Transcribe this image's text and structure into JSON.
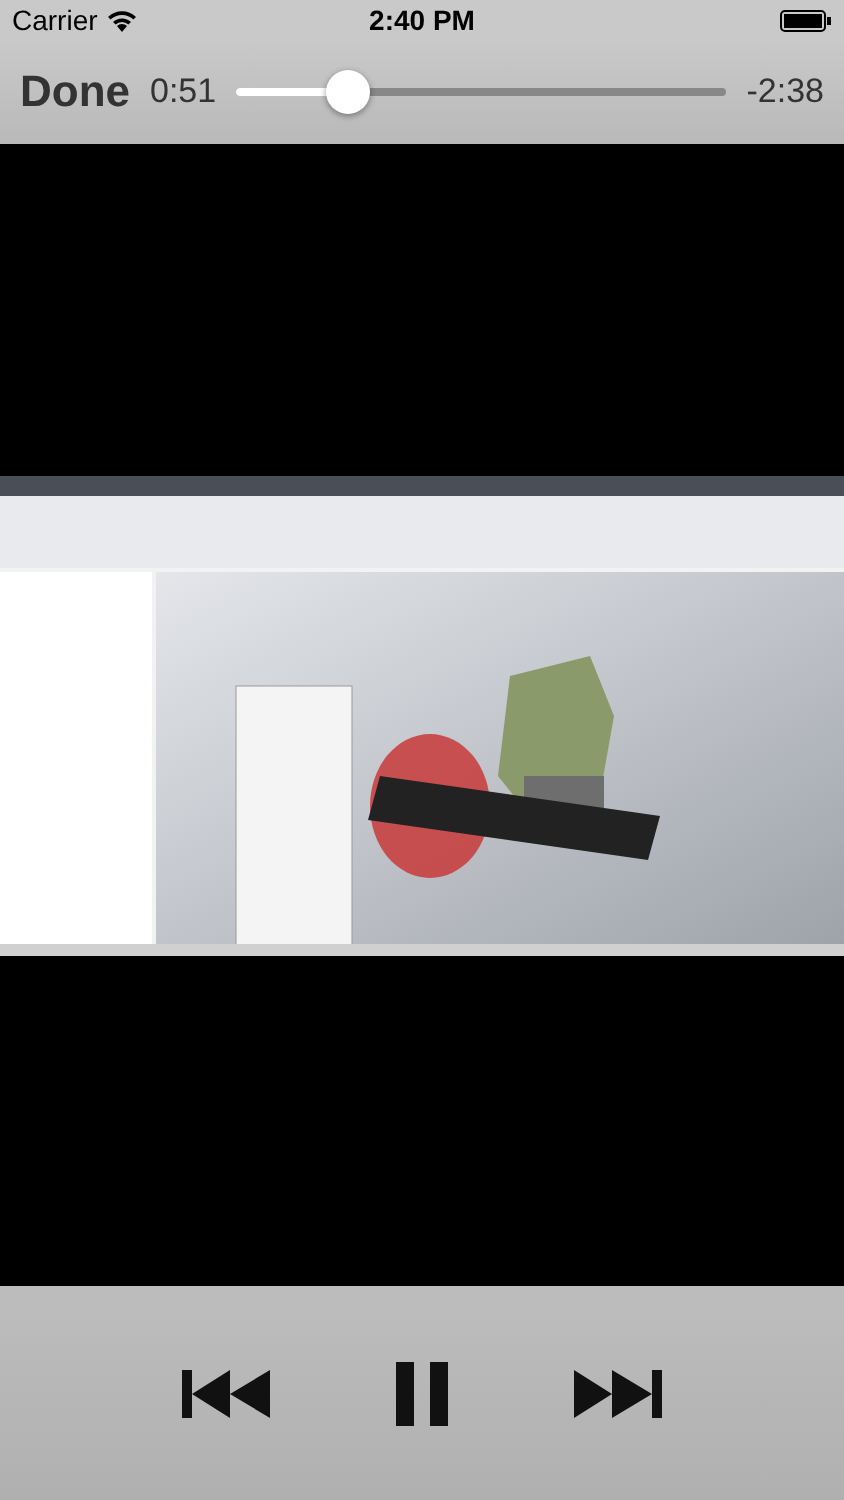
{
  "status_bar": {
    "carrier": "Carrier",
    "time": "2:40 PM"
  },
  "controls": {
    "done": "Done",
    "elapsed": "0:51",
    "remaining": "-2:38",
    "level": 0.23
  }
}
